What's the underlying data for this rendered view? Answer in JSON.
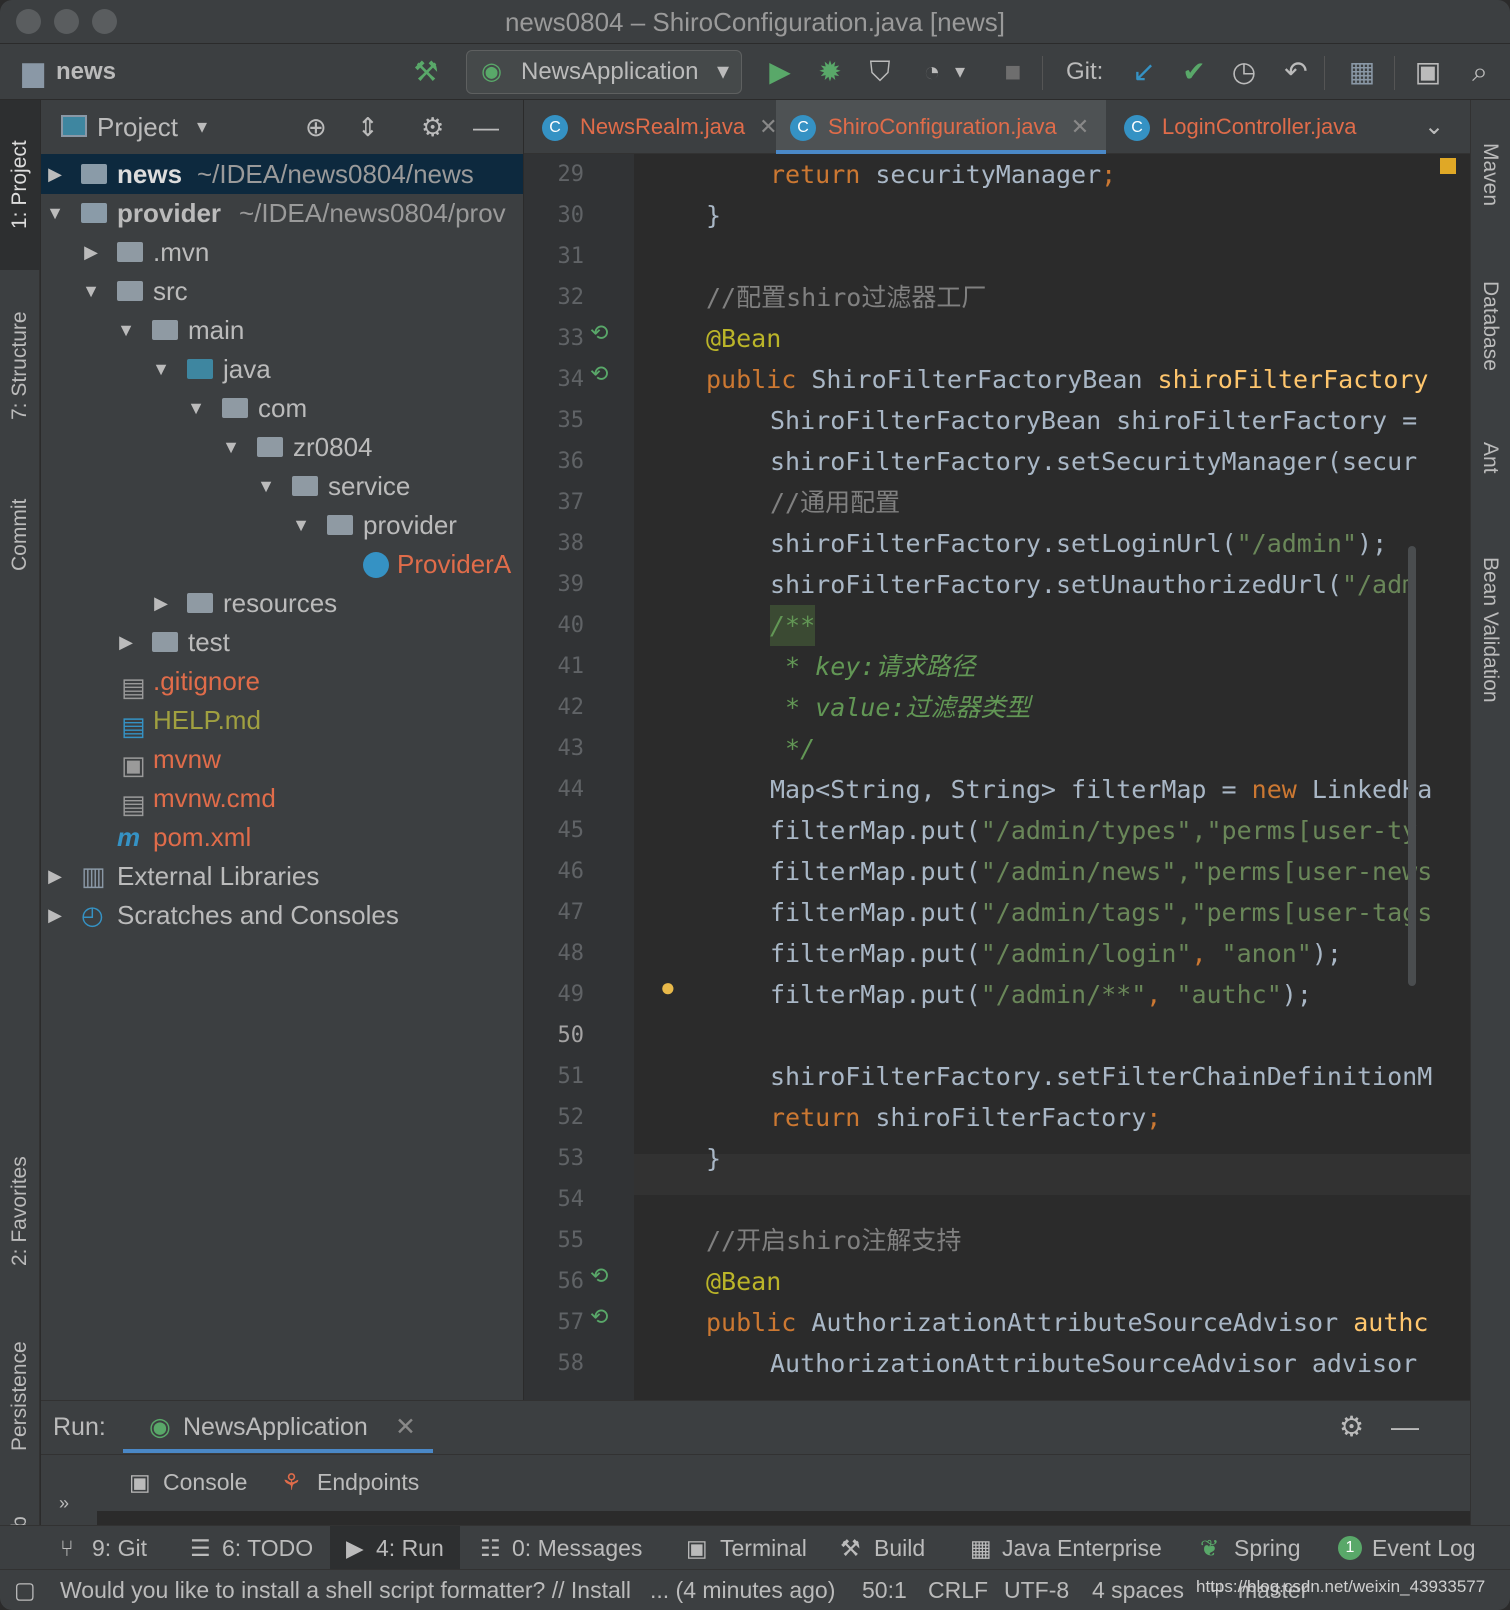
{
  "window": {
    "title": "news0804 – ShiroConfiguration.java [news]"
  },
  "toolbar": {
    "project": "news",
    "run_config": "NewsApplication",
    "git_label": "Git:"
  },
  "left_tabs": {
    "project": "1: Project",
    "structure": "7: Structure",
    "commit": "Commit",
    "favorites": "2: Favorites",
    "persistence": "Persistence",
    "web": "Web"
  },
  "right_tabs": {
    "maven": "Maven",
    "database": "Database",
    "ant": "Ant",
    "bean": "Bean Validation"
  },
  "project_panel": {
    "title": "Project",
    "tree": [
      {
        "name": "news",
        "path": "~/IDEA/news0804/news"
      },
      {
        "name": "provider",
        "path": "~/IDEA/news0804/prov"
      },
      {
        "name": ".mvn"
      },
      {
        "name": "src"
      },
      {
        "name": "main"
      },
      {
        "name": "java"
      },
      {
        "name": "com"
      },
      {
        "name": "zr0804"
      },
      {
        "name": "service"
      },
      {
        "name": "provider"
      },
      {
        "name": "ProviderA"
      },
      {
        "name": "resources"
      },
      {
        "name": "test"
      },
      {
        "name": ".gitignore"
      },
      {
        "name": "HELP.md"
      },
      {
        "name": "mvnw"
      },
      {
        "name": "mvnw.cmd"
      },
      {
        "name": "pom.xml"
      },
      {
        "name": "External Libraries"
      },
      {
        "name": "Scratches and Consoles"
      }
    ]
  },
  "editor": {
    "tabs": [
      {
        "label": "NewsRealm.java"
      },
      {
        "label": "ShiroConfiguration.java"
      },
      {
        "label": "LoginController.java"
      }
    ],
    "line_numbers": [
      "29",
      "30",
      "31",
      "32",
      "33",
      "34",
      "35",
      "36",
      "37",
      "38",
      "39",
      "40",
      "41",
      "42",
      "43",
      "44",
      "45",
      "46",
      "47",
      "48",
      "49",
      "50",
      "51",
      "52",
      "53",
      "54",
      "55",
      "56",
      "57",
      "58"
    ],
    "lines": {
      "l29a": "return",
      "l29b": " securityManager",
      "l30": "}",
      "l32": "//配置shiro过滤器工厂",
      "l33": "@Bean",
      "l34a": "public",
      "l34b": " ShiroFilterFactoryBean ",
      "l34c": "shiroFilterFactory",
      "l35": "ShiroFilterFactoryBean shiroFilterFactory =",
      "l36": "shiroFilterFactory.setSecurityManager(secur",
      "l37": "//通用配置",
      "l38a": "shiroFilterFactory.setLoginUrl(",
      "l38b": "\"/admin\"",
      "l38c": ");",
      "l39a": "shiroFilterFactory.setUnauthorizedUrl(",
      "l39b": "\"/adm",
      "l40": "/**",
      "l41": " * key:请求路径",
      "l42": " * value:过滤器类型",
      "l43": " */",
      "l44a": "Map<String, String> filterMap = ",
      "l44b": "new",
      "l44c": " LinkedHa",
      "l45a": "filterMap.put(",
      "l45b": "\"/admin/types\",\"perms[user-ty",
      "l46a": "filterMap.put(",
      "l46b": "\"/admin/news\",\"perms[user-news",
      "l47a": "filterMap.put(",
      "l47b": "\"/admin/tags\",\"perms[user-tags",
      "l48a": "filterMap.put(",
      "l48b": "\"/admin/login\"",
      ",l48c": ", ",
      "l48d": "\"anon\"",
      "l48e": ");",
      "l49a": "filterMap.put(",
      "l49b": "\"/admin/**\"",
      "l49c": ", ",
      "l49d": "\"authc\"",
      "l49e": ");",
      "l51": "shiroFilterFactory.setFilterChainDefinitionM",
      "l52a": "return",
      "l52b": " shiroFilterFactory",
      "l53": "}",
      "l55": "//开启shiro注解支持",
      "l56": "@Bean",
      "l57a": "public",
      "l57b": " AuthorizationAttributeSourceAdvisor ",
      "l57c": "authc",
      "l58": "AuthorizationAttributeSourceAdvisor advisor"
    }
  },
  "run_panel": {
    "label": "Run:",
    "config": "NewsApplication",
    "console": "Console",
    "endpoints": "Endpoints"
  },
  "bottom_tabs": [
    {
      "label": "9: Git"
    },
    {
      "label": "6: TODO"
    },
    {
      "label": "4: Run"
    },
    {
      "label": "0: Messages"
    },
    {
      "label": "Terminal"
    },
    {
      "label": "Build"
    },
    {
      "label": "Java Enterprise"
    },
    {
      "label": "Spring"
    },
    {
      "label": "Event Log"
    }
  ],
  "status": {
    "message": "Would you like to install a shell script formatter? // Install",
    "time": "... (4 minutes ago)",
    "position": "50:1",
    "line_sep": "CRLF",
    "encoding": "UTF-8",
    "indent": "4 spaces",
    "branch": "master",
    "watermark": "https://blog.csdn.net/weixin_43933577"
  },
  "colors": {
    "accent": "#3592c4",
    "keyword": "#cc7832",
    "string": "#6a8759",
    "file_modified": "#e06c4a"
  }
}
